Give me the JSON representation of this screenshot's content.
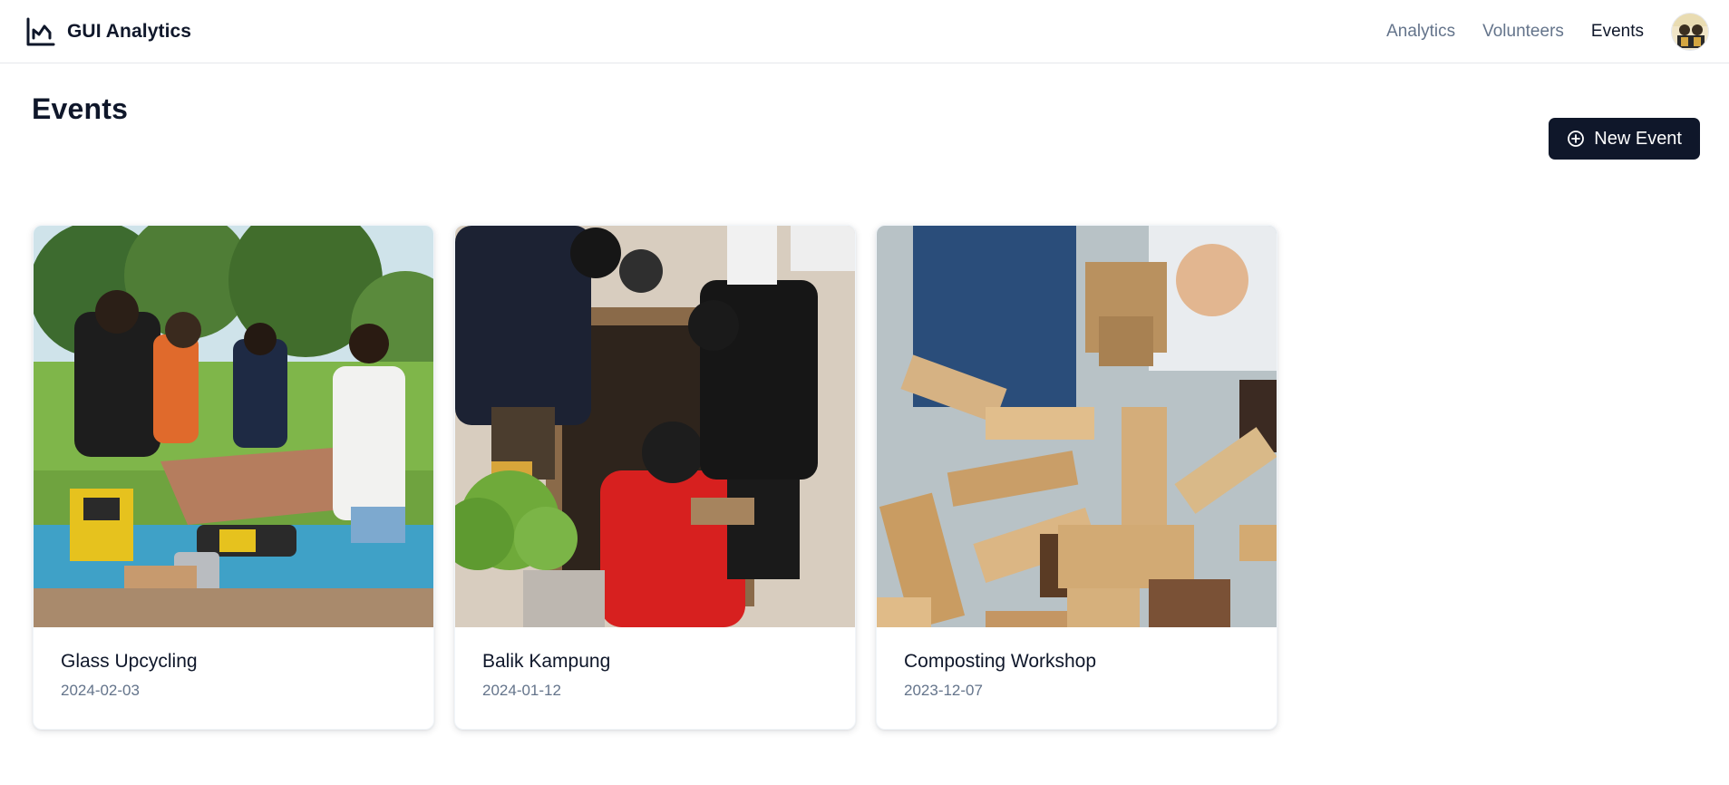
{
  "app": {
    "name": "GUI Analytics",
    "icon": "chart-line-icon"
  },
  "nav": {
    "items": [
      {
        "label": "Analytics",
        "active": false
      },
      {
        "label": "Volunteers",
        "active": false
      },
      {
        "label": "Events",
        "active": true
      }
    ],
    "avatar": "user-avatar"
  },
  "page": {
    "title": "Events",
    "new_button_label": "New Event",
    "new_button_icon": "plus-circle-icon"
  },
  "events": [
    {
      "title": "Glass Upcycling",
      "date": "2024-02-03"
    },
    {
      "title": "Balik Kampung",
      "date": "2024-01-12"
    },
    {
      "title": "Composting Workshop",
      "date": "2023-12-07"
    }
  ],
  "colors": {
    "primary": "#0f172a",
    "muted": "#64748b",
    "border": "#e5e7eb"
  }
}
